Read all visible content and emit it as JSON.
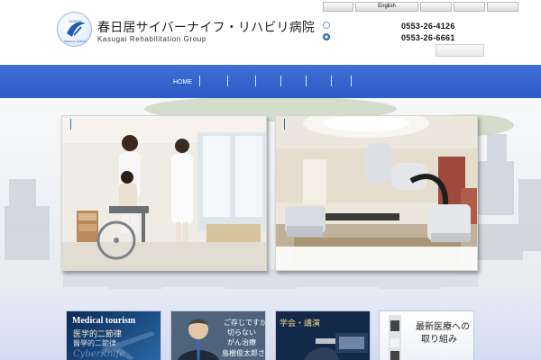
{
  "header": {
    "title": "春日居サイバーナイフ・リハビリ病院",
    "subtitle": "Kasugai Rehabilitation Group",
    "logo_icon": "hospital-emblem-icon",
    "logo_text_top": "KASUGAI",
    "logo_text_bottom": "MEDICAL GROUP",
    "language_buttons": [
      "",
      "English",
      "",
      "",
      ""
    ],
    "phones": [
      "0553-26-4126",
      "0553-26-6661"
    ],
    "small_icons": [
      "twitter-icon",
      "circle-link-icon"
    ]
  },
  "nav": {
    "items": [
      "HOME",
      "",
      "",
      "",
      "",
      "",
      ""
    ]
  },
  "hero": {
    "cards": [
      {
        "name": "rehabilitation-photo",
        "alt_icon": "photo-icon"
      },
      {
        "name": "cyberknife-photo",
        "alt_icon": "photo-icon"
      }
    ]
  },
  "banners": [
    {
      "title_en": "Medical tourism",
      "lines": [
        "医学的二節律",
        "醫學的二節律",
        "CyberKnife"
      ]
    },
    {
      "lines": [
        "ご存じですか？",
        "切らない",
        "がん治療",
        "島樹俊太郎さん"
      ]
    },
    {
      "lines": [
        "学会・講演"
      ]
    },
    {
      "lines": [
        "最新医療への",
        "取り組み"
      ]
    }
  ],
  "colors": {
    "nav_blue": "#2f62cd",
    "strip_bg": "#dbe1f4",
    "accent_mark": "#3367d6"
  }
}
